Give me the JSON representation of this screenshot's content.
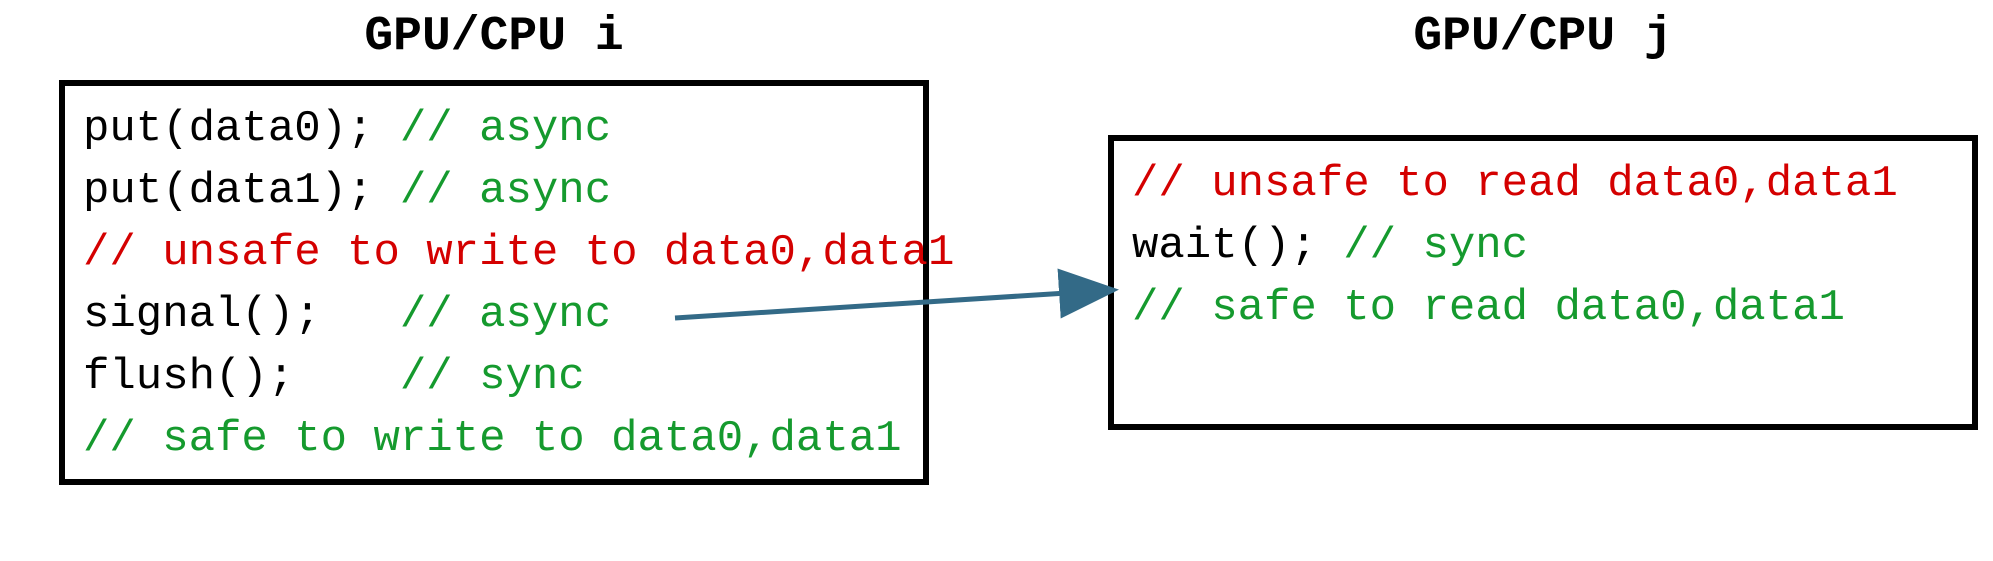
{
  "chart_data": {
    "type": "diagram",
    "title": "",
    "processors": [
      {
        "label": "GPU/CPU i",
        "code": [
          {
            "tokens": [
              {
                "text": "put(data0); ",
                "style": "code"
              },
              {
                "text": "// async",
                "style": "green"
              }
            ]
          },
          {
            "tokens": [
              {
                "text": "put(data1); ",
                "style": "code"
              },
              {
                "text": "// async",
                "style": "green"
              }
            ]
          },
          {
            "tokens": [
              {
                "text": "// unsafe to write to data0,data1",
                "style": "red"
              }
            ]
          },
          {
            "tokens": [
              {
                "text": "signal();   ",
                "style": "code"
              },
              {
                "text": "// async",
                "style": "green"
              }
            ]
          },
          {
            "tokens": [
              {
                "text": "flush();    ",
                "style": "code"
              },
              {
                "text": "// sync",
                "style": "green"
              }
            ]
          },
          {
            "tokens": [
              {
                "text": "// safe to write to data0,data1",
                "style": "green"
              }
            ]
          }
        ]
      },
      {
        "label": "GPU/CPU j",
        "code": [
          {
            "tokens": [
              {
                "text": "",
                "style": "code"
              }
            ]
          },
          {
            "tokens": [
              {
                "text": "// unsafe to read data0,data1",
                "style": "red"
              }
            ]
          },
          {
            "tokens": [
              {
                "text": "wait(); ",
                "style": "code"
              },
              {
                "text": "// sync",
                "style": "green"
              }
            ]
          },
          {
            "tokens": [
              {
                "text": "// safe to read data0,data1",
                "style": "green"
              }
            ]
          }
        ]
      }
    ],
    "arrow": {
      "from": {
        "processor": 0,
        "line_index": 3,
        "after_token": "// async"
      },
      "to": {
        "processor": 1,
        "line_index": 2,
        "before_token": "wait();"
      },
      "color": "#336a87"
    }
  }
}
